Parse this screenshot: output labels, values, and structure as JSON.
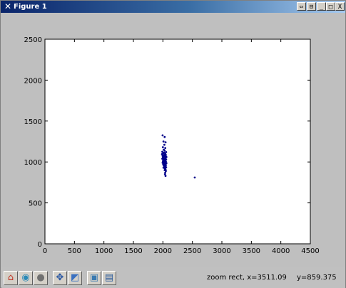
{
  "window": {
    "title": "Figure 1",
    "buttons": [
      "⇔",
      "⊟",
      "_",
      "□",
      "X"
    ]
  },
  "toolbar": {
    "tools": [
      {
        "name": "home-icon",
        "glyph": "⌂",
        "color": "#c03020"
      },
      {
        "name": "back-icon",
        "glyph": "◉",
        "color": "#2a8ab8"
      },
      {
        "name": "forward-icon",
        "glyph": "●",
        "color": "#707070"
      },
      {
        "name": "pan-icon",
        "glyph": "✥",
        "color": "#2050a0"
      },
      {
        "name": "zoom-icon",
        "glyph": "◩",
        "color": "#3a70c0"
      },
      {
        "name": "subplots-icon",
        "glyph": "▣",
        "color": "#3a7ab0"
      },
      {
        "name": "save-icon",
        "glyph": "▤",
        "color": "#2a5a9a"
      }
    ],
    "status_left": "zoom rect, x=3511.09",
    "status_right": "y=859.375"
  },
  "chart_data": {
    "type": "scatter",
    "xlim": [
      0,
      4500
    ],
    "ylim": [
      0,
      2500
    ],
    "xticks": [
      "0",
      "500",
      "1000",
      "1500",
      "2000",
      "2500",
      "3000",
      "3500",
      "4000",
      "4500"
    ],
    "yticks": [
      "0",
      "500",
      "1000",
      "1500",
      "2000",
      "2500"
    ],
    "grid": false,
    "marker_color": "#00008b",
    "points": [
      [
        1995,
        1325
      ],
      [
        2030,
        1305
      ],
      [
        2010,
        1250
      ],
      [
        2045,
        1240
      ],
      [
        2025,
        1210
      ],
      [
        2000,
        1180
      ],
      [
        2040,
        1170
      ],
      [
        2015,
        1150
      ],
      [
        2030,
        1140
      ],
      [
        1990,
        1125
      ],
      [
        2055,
        1120
      ],
      [
        2020,
        1115
      ],
      [
        2005,
        1105
      ],
      [
        2040,
        1100
      ],
      [
        1985,
        1095
      ],
      [
        2030,
        1090
      ],
      [
        2050,
        1085
      ],
      [
        2010,
        1080
      ],
      [
        1995,
        1075
      ],
      [
        2035,
        1070
      ],
      [
        2020,
        1065
      ],
      [
        2060,
        1060
      ],
      [
        2000,
        1055
      ],
      [
        2045,
        1050
      ],
      [
        2015,
        1045
      ],
      [
        1990,
        1040
      ],
      [
        2030,
        1035
      ],
      [
        2055,
        1030
      ],
      [
        2010,
        1025
      ],
      [
        2040,
        1020
      ],
      [
        2025,
        1015
      ],
      [
        2000,
        1010
      ],
      [
        2050,
        1005
      ],
      [
        2015,
        1000
      ],
      [
        2035,
        995
      ],
      [
        1995,
        990
      ],
      [
        2060,
        985
      ],
      [
        2020,
        980
      ],
      [
        2045,
        975
      ],
      [
        2005,
        970
      ],
      [
        2030,
        965
      ],
      [
        2050,
        960
      ],
      [
        2015,
        955
      ],
      [
        2040,
        950
      ],
      [
        2025,
        940
      ],
      [
        2055,
        935
      ],
      [
        2010,
        930
      ],
      [
        2035,
        920
      ],
      [
        2045,
        910
      ],
      [
        2030,
        900
      ],
      [
        2050,
        890
      ],
      [
        2040,
        870
      ],
      [
        2035,
        850
      ],
      [
        2045,
        830
      ],
      [
        2540,
        810
      ]
    ]
  }
}
